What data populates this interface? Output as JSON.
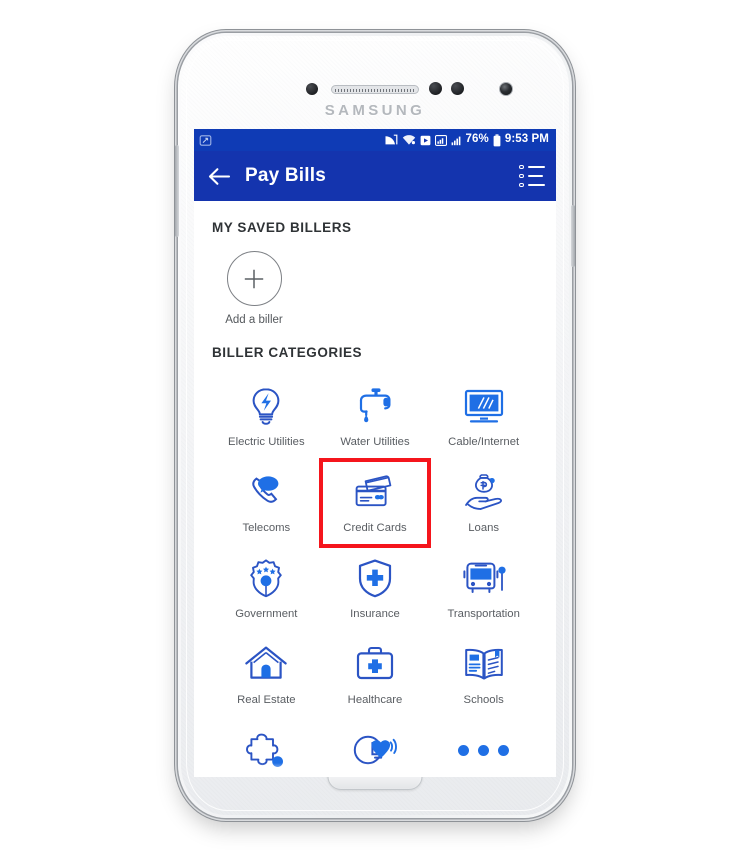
{
  "device": {
    "brand": "SAMSUNG",
    "hardware": {
      "earpiece": "earpiece-speaker",
      "front_camera": "front-camera",
      "home_button": "home-button",
      "volume_button": "volume-button",
      "power_button": "power-button"
    }
  },
  "status_bar": {
    "background": "#0f3bb5",
    "left_icons": [
      "screenshot-icon"
    ],
    "right_icons": [
      "cast-icon",
      "wifi-icon",
      "sd-card-icon",
      "signal-icon",
      "signal-secondary-icon"
    ],
    "battery_percent": "76%",
    "clock": "9:53 PM"
  },
  "app_bar": {
    "background": "#1434ae",
    "back_icon": "back-arrow-icon",
    "title": "Pay Bills",
    "menu_icon": "list-menu-icon"
  },
  "sections": {
    "saved_billers_title": "MY SAVED BILLERS",
    "categories_title": "BILLER CATEGORIES"
  },
  "saved_billers": {
    "add_biller_label": "Add a biller",
    "add_icon": "plus-icon"
  },
  "categories": [
    {
      "label": "Electric Utilities",
      "icon": "lightbulb-icon",
      "highlighted": false
    },
    {
      "label": "Water Utilities",
      "icon": "faucet-icon",
      "highlighted": false
    },
    {
      "label": "Cable/Internet",
      "icon": "monitor-icon",
      "highlighted": false
    },
    {
      "label": "Telecoms",
      "icon": "phone-chat-icon",
      "highlighted": false
    },
    {
      "label": "Credit Cards",
      "icon": "credit-card-icon",
      "highlighted": true
    },
    {
      "label": "Loans",
      "icon": "hand-money-bag-icon",
      "highlighted": false
    },
    {
      "label": "Government",
      "icon": "shield-stars-icon",
      "highlighted": false
    },
    {
      "label": "Insurance",
      "icon": "shield-cross-icon",
      "highlighted": false
    },
    {
      "label": "Transportation",
      "icon": "bus-icon",
      "highlighted": false
    },
    {
      "label": "Real Estate",
      "icon": "house-icon",
      "highlighted": false
    },
    {
      "label": "Healthcare",
      "icon": "medical-kit-icon",
      "highlighted": false
    },
    {
      "label": "Schools",
      "icon": "open-book-icon",
      "highlighted": false
    },
    {
      "label": "",
      "icon": "puzzle-piece-icon",
      "highlighted": false
    },
    {
      "label": "",
      "icon": "charity-heart-icon",
      "highlighted": false
    },
    {
      "label": "",
      "icon": "more-dots-icon",
      "highlighted": false
    }
  ],
  "colors": {
    "app_bar_blue": "#1434ae",
    "status_bar_blue": "#0f3bb5",
    "icon_blue": "#1f6fe5",
    "icon_navy": "#2b54c4",
    "highlight_red": "#f5151c",
    "label_gray": "#595d62"
  }
}
